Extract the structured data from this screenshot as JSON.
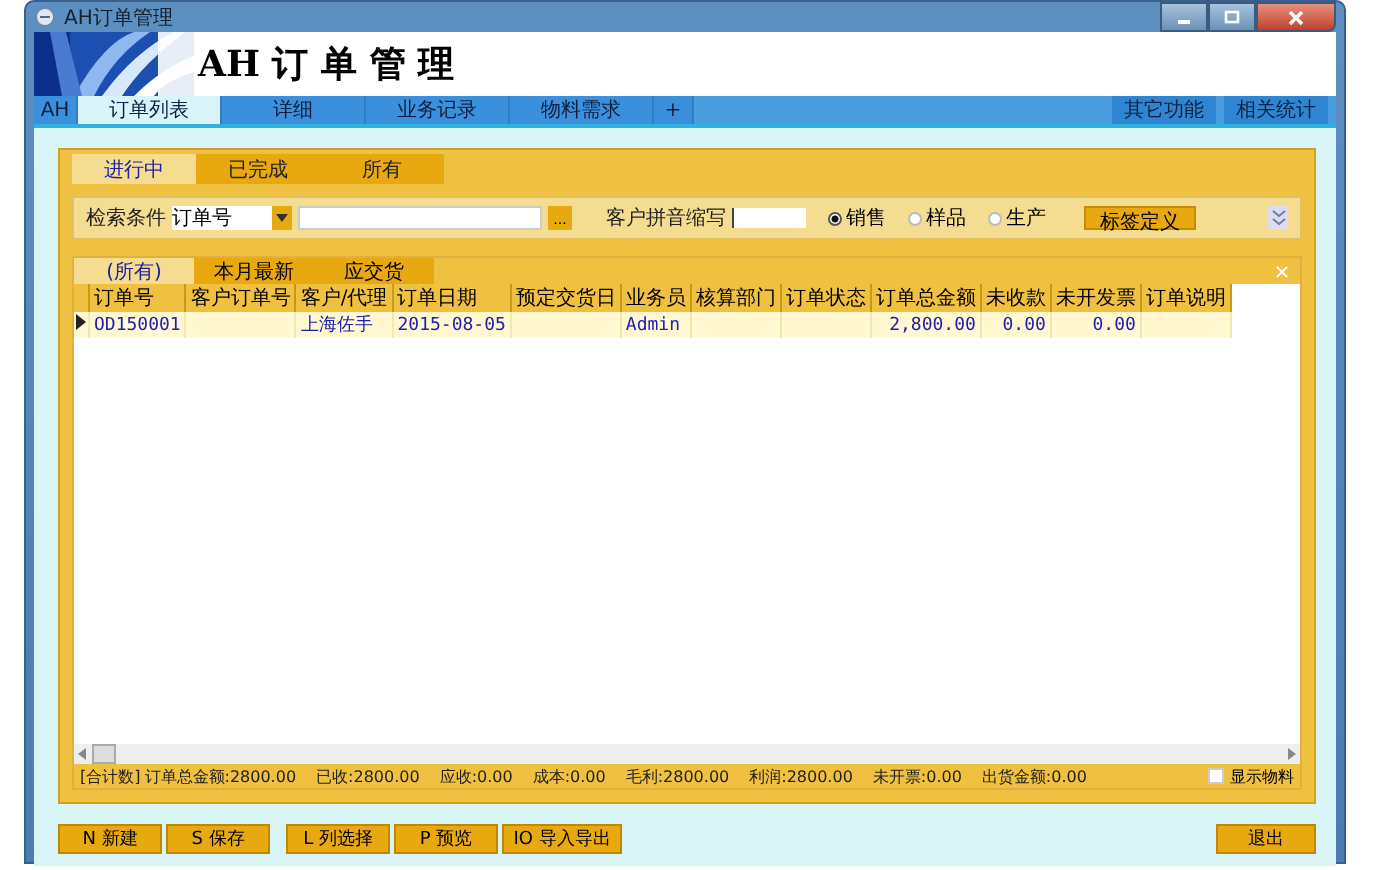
{
  "window": {
    "title": "AH订单管理"
  },
  "banner": {
    "title": "AH 订 单 管 理"
  },
  "main_tabs": [
    {
      "label": "AH",
      "selected": false
    },
    {
      "label": "订单列表",
      "selected": true
    },
    {
      "label": "详细",
      "selected": false
    },
    {
      "label": "业务记录",
      "selected": false
    },
    {
      "label": "物料需求",
      "selected": false
    },
    {
      "label": "+",
      "selected": false
    }
  ],
  "right_tabs": [
    "其它功能",
    "相关统计"
  ],
  "status_tabs": [
    {
      "label": "进行中",
      "selected": true
    },
    {
      "label": "已完成",
      "selected": false
    },
    {
      "label": "所有",
      "selected": false
    }
  ],
  "search": {
    "label": "检索条件",
    "field": "订单号",
    "browse": "...",
    "pinyin_label": "客户拼音缩写",
    "radios": [
      {
        "label": "销售",
        "selected": true
      },
      {
        "label": "样品",
        "selected": false
      },
      {
        "label": "生产",
        "selected": false
      }
    ],
    "tag_button": "标签定义"
  },
  "filter_tabs": [
    {
      "label": "(所有)",
      "selected": true
    },
    {
      "label": "本月最新",
      "selected": false
    },
    {
      "label": "应交货",
      "selected": false
    }
  ],
  "table": {
    "columns": [
      "订单号",
      "客户订单号",
      "客户/代理",
      "订单日期",
      "预定交货日",
      "业务员",
      "核算部门",
      "订单状态",
      "订单总金额",
      "未收款",
      "未开发票",
      "订单说明"
    ],
    "rows": [
      {
        "selected": true,
        "cells": [
          "OD150001",
          "",
          "上海佐手",
          "2015-08-05",
          "",
          "Admin",
          "",
          "",
          "2,800.00",
          "0.00",
          "0.00",
          ""
        ]
      }
    ]
  },
  "totals": {
    "label": "[合计数]",
    "items": [
      "订单总金额:2800.00",
      "已收:2800.00",
      "应收:0.00",
      "成本:0.00",
      "毛利:2800.00",
      "利润:2800.00",
      "未开票:0.00",
      "出货金额:0.00"
    ],
    "show_materials": {
      "label": "显示物料",
      "checked": false
    }
  },
  "buttons": [
    "N 新建",
    "S 保存",
    "L 列选择",
    "P 预览",
    "IO 导入导出"
  ],
  "exit_button": "退出"
}
